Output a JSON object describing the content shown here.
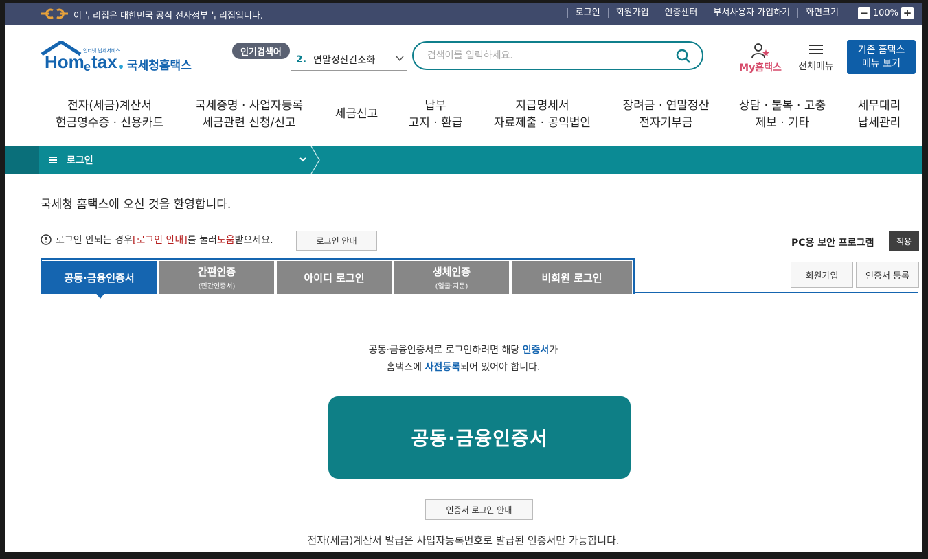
{
  "gov_bar": {
    "text": "이 누리집은 대한민국 공식 전자정부 누리집입니다.",
    "links": [
      "로그인",
      "회원가입",
      "인증센터",
      "부서사용자 가입하기",
      "화면크기"
    ],
    "zoom": "100%"
  },
  "header": {
    "logo_text": "국세청홈택스",
    "logo_small": "인터넷 납세서비스",
    "popular_label": "인기검색어",
    "popular_rank": "2.",
    "popular_term": "연말정산간소화",
    "search_placeholder": "검색어를 입력하세요.",
    "my_label": "My홈택스",
    "allmenu_label": "전체메뉴",
    "old_menu_line1": "기존 홈택스",
    "old_menu_line2": "메뉴 보기"
  },
  "gnb": [
    {
      "line1": "전자(세금)계산서",
      "line2": "현금영수증 · 신용카드"
    },
    {
      "line1": "국세증명 · 사업자등록",
      "line2": "세금관련 신청/신고"
    },
    {
      "line1": "세금신고",
      "line2": ""
    },
    {
      "line1": "납부",
      "line2": "고지 · 환급"
    },
    {
      "line1": "지급명세서",
      "line2": "자료제출 · 공익법인"
    },
    {
      "line1": "장려금 · 연말정산",
      "line2": "전자기부금"
    },
    {
      "line1": "상담 · 불복 · 고충",
      "line2": "제보 · 기타"
    },
    {
      "line1": "세무대리",
      "line2": "납세관리"
    }
  ],
  "location": {
    "label": "로그인"
  },
  "main": {
    "welcome": "국세청 홈택스에 오신 것을 환영합니다.",
    "notice_pre": "로그인 안되는 경우 ",
    "notice_link": "[로그인 안내]",
    "notice_mid": "를 눌러 ",
    "notice_help": "도움",
    "notice_post": "받으세요.",
    "login_guide_btn": "로그인 안내",
    "pc_security": "PC용 보안 프로그램",
    "apply_btn": "적용",
    "tabs": [
      {
        "label": "공동·금융인증서",
        "sub": ""
      },
      {
        "label": "간편인증",
        "sub": "(민간인증서)"
      },
      {
        "label": "아이디 로그인",
        "sub": ""
      },
      {
        "label": "생체인증",
        "sub": "(얼굴·지문)"
      },
      {
        "label": "비회원 로그인",
        "sub": ""
      }
    ],
    "signup_btn": "회원가입",
    "cert_reg_btn": "인증서 등록",
    "desc1_pre": "공동·금융인증서로 로그인하려면 해당 ",
    "desc1_blue": "인증서",
    "desc1_post": "가",
    "desc2_pre": "홈택스에 ",
    "desc2_blue": "사전등록",
    "desc2_post": "되어 있어야 합니다.",
    "cert_big_btn": "공동·금융인증서",
    "cert_guide_btn": "인증서 로그인 안내",
    "bottom_note": "전자(세금)계산서 발급은 사업자등록번호로 발급된 인증서만 가능합니다."
  },
  "colors": {
    "gov_bar": "#3f4a6b",
    "teal": "#0b8a94",
    "blue": "#1565b0",
    "tab_gray": "#878787",
    "pink": "#d64a6a"
  }
}
